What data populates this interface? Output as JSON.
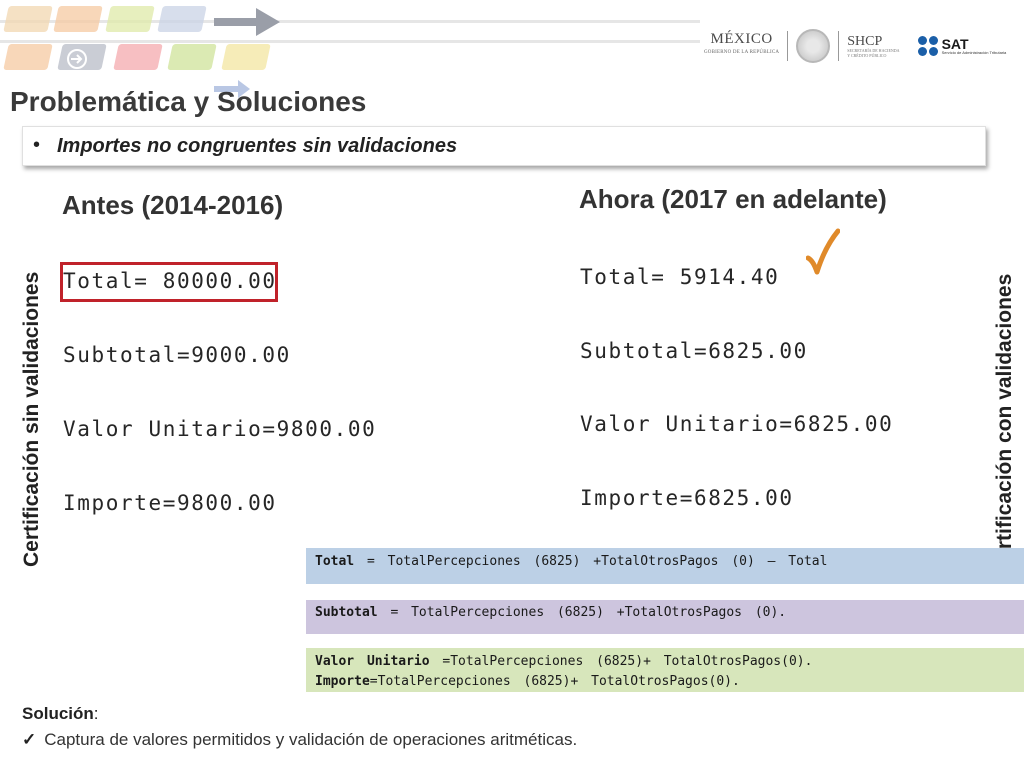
{
  "header": {
    "logos": {
      "mexico": "MÉXICO",
      "mexico_sub": "GOBIERNO DE LA REPÚBLICA",
      "shcp": "SHCP",
      "shcp_sub1": "SECRETARÍA DE HACIENDA",
      "shcp_sub2": "Y CRÉDITO PÚBLICO",
      "sat": "SAT",
      "sat_sub": "Servicio de Administración Tributaria"
    }
  },
  "title": "Problemática y Soluciones",
  "subtitle": {
    "bullet": "•",
    "text": "Importes no congruentes  sin validaciones"
  },
  "before": {
    "heading": "Antes (2014-2016)",
    "lines": [
      "Total= 80000.00",
      "Subtotal=9000.00",
      "Valor Unitario=9800.00",
      "Importe=9800.00"
    ]
  },
  "after": {
    "heading": "Ahora (2017 en adelante)",
    "lines": [
      "Total= 5914.40",
      "Subtotal=6825.00",
      "Valor Unitario=6825.00",
      "Importe=6825.00"
    ]
  },
  "vertical_labels": {
    "left": "Certificación sin validaciones",
    "right": "Certificación con validaciones"
  },
  "formulas": {
    "total_key": "Total",
    "total_rest": "   = TotalPercepciones (6825) +TotalOtrosPagos (0) – Total",
    "subtotal_key": "Subtotal",
    "subtotal_rest": " = TotalPercepciones (6825) +TotalOtrosPagos (0).",
    "valor_key": "Valor Unitario",
    "valor_rest": " =TotalPercepciones (6825)+ TotalOtrosPagos(0).",
    "importe_key": "Importe",
    "importe_rest": "=TotalPercepciones (6825)+ TotalOtrosPagos(0)."
  },
  "solution": {
    "label": "Solución",
    "colon": ":",
    "check": "✓",
    "item": "Captura de valores permitidos y validación de operaciones aritméticas."
  },
  "colors": {
    "highlight_red": "#c0222a",
    "check_orange": "#e08a2a",
    "box_blue": "#bcd0e6",
    "box_purple": "#cdc5de",
    "box_green": "#d7e6bb"
  }
}
